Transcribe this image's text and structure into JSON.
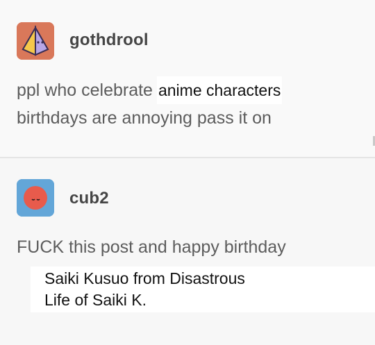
{
  "posts": [
    {
      "username": "gothdrool",
      "line1_before": "ppl who celebrate",
      "line1_overlay": "anime characters",
      "line2": "birthdays are annoying pass it on",
      "avatar": {
        "icon": "pyramid-icon",
        "background": "#d9785a"
      }
    },
    {
      "username": "cub2",
      "text": "FUCK this post and happy birthday",
      "avatar": {
        "icon": "moon-face-icon",
        "background": "#63a6d8"
      }
    }
  ],
  "caption": {
    "line1": "Saiki Kusuo from Disastrous",
    "line2": "Life of Saiki K."
  },
  "colors": {
    "page_background": "#f7f7f7",
    "text": "#5c5c5c",
    "username": "#454545",
    "overlay_background": "#ffffff",
    "overlay_text": "#111111"
  }
}
